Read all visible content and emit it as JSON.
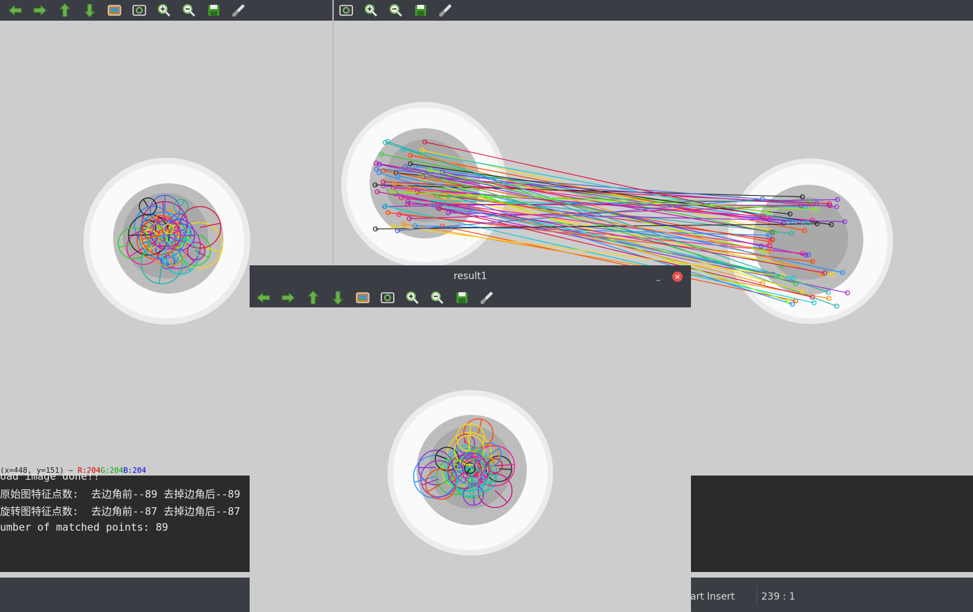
{
  "main_window": {
    "toolbar_left": [
      {
        "name": "back-icon",
        "tip": "arrow-left"
      },
      {
        "name": "forward-icon",
        "tip": "arrow-right"
      },
      {
        "name": "up-icon",
        "tip": "arrow-up"
      },
      {
        "name": "down-icon",
        "tip": "arrow-down"
      },
      {
        "name": "image-icon",
        "tip": "image"
      },
      {
        "name": "fit-view-icon",
        "tip": "fit"
      },
      {
        "name": "zoom-in-icon",
        "tip": "zoom-in"
      },
      {
        "name": "zoom-out-icon",
        "tip": "zoom-out"
      },
      {
        "name": "save-icon",
        "tip": "save"
      },
      {
        "name": "brush-icon",
        "tip": "brush"
      }
    ],
    "toolbar_right": [
      {
        "name": "fit-view-icon",
        "tip": "fit"
      },
      {
        "name": "zoom-in-icon",
        "tip": "zoom-in"
      },
      {
        "name": "zoom-out-icon",
        "tip": "zoom-out"
      },
      {
        "name": "save-icon",
        "tip": "save"
      },
      {
        "name": "brush-icon",
        "tip": "brush"
      }
    ],
    "pixel_readout": {
      "coords": "(x=448, y=151) ~",
      "r": "R:204",
      "g": "G:204",
      "b": "B:204"
    }
  },
  "console": {
    "lines": [
      "oad image done!!",
      "原始图特征点数:  去边角前--89 去掉边角后--89",
      "旋转图特征点数:  去边角前--87 去掉边角后--87",
      "umber of matched points: 89"
    ]
  },
  "statusbar": {
    "mode": "art Insert",
    "position": "239 : 1"
  },
  "result_window": {
    "title": "result1",
    "minimize_label": "–",
    "close_label": "×",
    "toolbar": [
      {
        "name": "back-icon",
        "tip": "arrow-left"
      },
      {
        "name": "forward-icon",
        "tip": "arrow-right"
      },
      {
        "name": "up-icon",
        "tip": "arrow-up"
      },
      {
        "name": "down-icon",
        "tip": "arrow-down"
      },
      {
        "name": "image-icon",
        "tip": "image"
      },
      {
        "name": "fit-view-icon",
        "tip": "fit"
      },
      {
        "name": "zoom-in-icon",
        "tip": "zoom-in"
      },
      {
        "name": "zoom-out-icon",
        "tip": "zoom-out"
      },
      {
        "name": "save-icon",
        "tip": "save"
      },
      {
        "name": "brush-icon",
        "tip": "brush"
      }
    ]
  },
  "colors": {
    "toolbar_bg": "#3a3d44",
    "canvas_bg": "#cdcdcd",
    "console_bg": "#2b2b2b",
    "icon_green": "#6ab04c",
    "readout_r": "#dd0000",
    "readout_g": "#00aa00",
    "readout_b": "#0000dd"
  }
}
